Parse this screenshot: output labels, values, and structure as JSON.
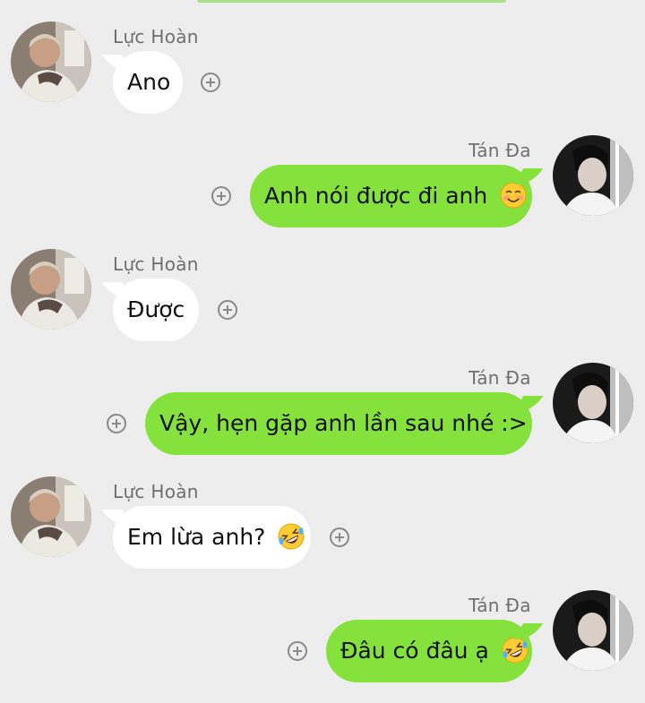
{
  "contacts": {
    "left_name": "Lực Hoàn",
    "right_name": "Tán Đa"
  },
  "messages": [
    {
      "side": "in",
      "sender": "Lực Hoàn",
      "text": "Ano",
      "emoji": ""
    },
    {
      "side": "out",
      "sender": "Tán Đa",
      "text": "Anh nói được đi anh",
      "emoji": "smiling-blush-emoji"
    },
    {
      "side": "in",
      "sender": "Lực Hoàn",
      "text": "Được",
      "emoji": ""
    },
    {
      "side": "out",
      "sender": "Tán Đa",
      "text": "Vậy, hẹn gặp anh lần sau nhé :>",
      "emoji": ""
    },
    {
      "side": "in",
      "sender": "Lực Hoàn",
      "text": "Em lừa anh?",
      "emoji": "rolling-laughing-emoji"
    },
    {
      "side": "out",
      "sender": "Tán Đa",
      "text": "Đâu có đâu ạ",
      "emoji": "rolling-laughing-emoji"
    }
  ],
  "colors": {
    "background": "#ededed",
    "outgoing_bubble": "#85e23d",
    "incoming_bubble": "#ffffff",
    "sender_text": "#6f6f6f"
  }
}
